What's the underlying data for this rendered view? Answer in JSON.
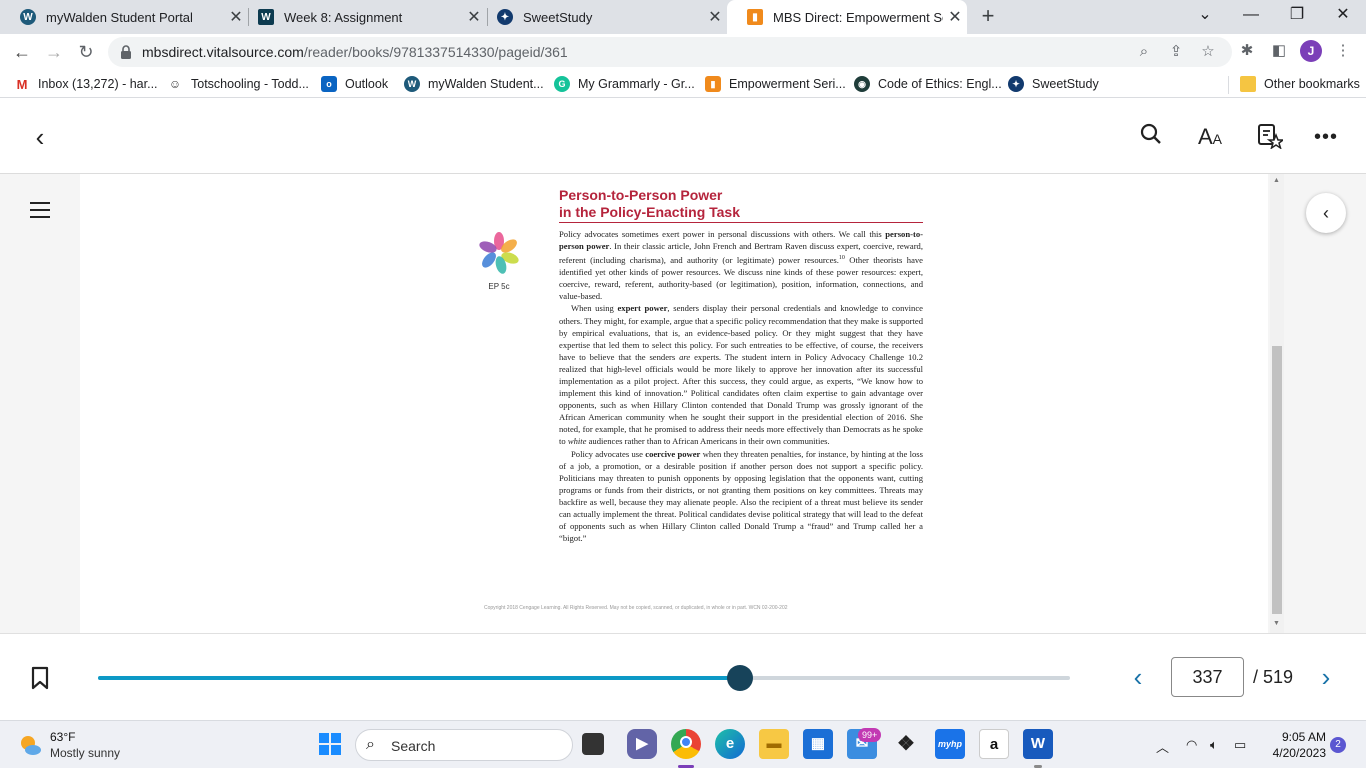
{
  "browser": {
    "tabs": [
      {
        "title": "myWalden Student Portal",
        "icon": "walden-w-icon"
      },
      {
        "title": "Week 8: Assignment",
        "icon": "walden-w-icon"
      },
      {
        "title": "SweetStudy",
        "icon": "sweetstudy-icon"
      },
      {
        "title": "MBS Direct: Empowerment Series",
        "icon": "mbs-icon",
        "active": true
      }
    ],
    "new_tab": "+",
    "url_host": "mbsdirect.vitalsource.com",
    "url_path": "/reader/books/9781337514330/pageid/361",
    "profile_initial": "J",
    "bookmarks": [
      {
        "label": "Inbox (13,272) - har...",
        "icon": "gmail-icon"
      },
      {
        "label": "Totschooling - Todd...",
        "icon": "totschooling-icon"
      },
      {
        "label": "Outlook",
        "icon": "outlook-icon"
      },
      {
        "label": "myWalden Student...",
        "icon": "walden-w-icon"
      },
      {
        "label": "My Grammarly - Gr...",
        "icon": "grammarly-icon"
      },
      {
        "label": "Empowerment Seri...",
        "icon": "mbs-icon"
      },
      {
        "label": "Code of Ethics: Engl...",
        "icon": "nasw-icon"
      },
      {
        "label": "SweetStudy",
        "icon": "sweetstudy-icon"
      }
    ],
    "other_bookmarks": "Other bookmarks"
  },
  "book": {
    "heading_line1": "Person-to-Person Power",
    "heading_line2": "in the Policy-Enacting Task",
    "ep_label": "EP 5c",
    "p1_a": "Policy advocates sometimes exert power in personal discussions with others. We call this ",
    "p1_b": "person-to-person power",
    "p1_c": ". In their classic article, John French and Bertram Raven discuss expert, coercive, reward, referent (including charisma), and authority (or legitimate) power resources.",
    "p1_sup": "10",
    "p1_d": " Other theorists have identified yet other kinds of power resources. We discuss nine kinds of these power resources: expert, coercive, reward, referent, authority-based (or legitimation), position, information, connections, and value-based.",
    "p2_a": "When using ",
    "p2_b": "expert power",
    "p2_c": ", senders display their personal credentials and knowledge to convince others. They might, for example, argue that a specific policy recommendation that they make is supported by empirical evaluations, that is, an evidence-based policy. Or they might suggest that they have expertise that led them to select this policy. For such entreaties to be effective, of course, the receivers have to believe that the senders ",
    "p2_d": "are",
    "p2_e": " experts. The student intern in Policy Advocacy Challenge 10.2 realized that high-level officials would be more likely to approve her innovation after its successful implementation as a pilot project. After this success, they could argue, as experts, “We know how to implement this kind of innovation.” Political candidates often claim expertise to gain advantage over opponents, such as when Hillary Clinton contended that Donald Trump was grossly ignorant of the African American community when he sought their support in the presidential election of 2016. She noted, for example, that he promised to address their needs more effectively than Democrats as he spoke to ",
    "p2_f": "white",
    "p2_g": " audiences rather than to African Americans in their own communities.",
    "p3_a": "Policy advocates use ",
    "p3_b": "coercive power",
    "p3_c": " when they threaten penalties, for instance, by hinting at the loss of a job, a promotion, or a desirable position if another person does not support a specific policy. Politicians may threaten to punish opponents by opposing legislation that the opponents want, cutting programs or funds from their districts, or not granting them positions on key committees. Threats may backfire as well, because they may alienate people. Also the recipient of a threat must believe its sender can actually implement the threat. Political candidates devise political strategy that will lead to the defeat of opponents such as when Hillary Clinton called Donald Trump a “fraud” and Trump called her a “bigot.”",
    "copyright": "Copyright 2018 Cengage Learning. All Rights Reserved. May not be copied, scanned, or duplicated, in whole or in part. WCN 02-200-202"
  },
  "reader": {
    "current_page": "337",
    "total_pages": "/ 519",
    "progress_fraction": 0.66
  },
  "taskbar": {
    "temperature": "63°F",
    "weather": "Mostly sunny",
    "search_placeholder": "Search",
    "mail_badge": "99+",
    "time": "9:05 AM",
    "date": "4/20/2023",
    "notifications": "2"
  }
}
